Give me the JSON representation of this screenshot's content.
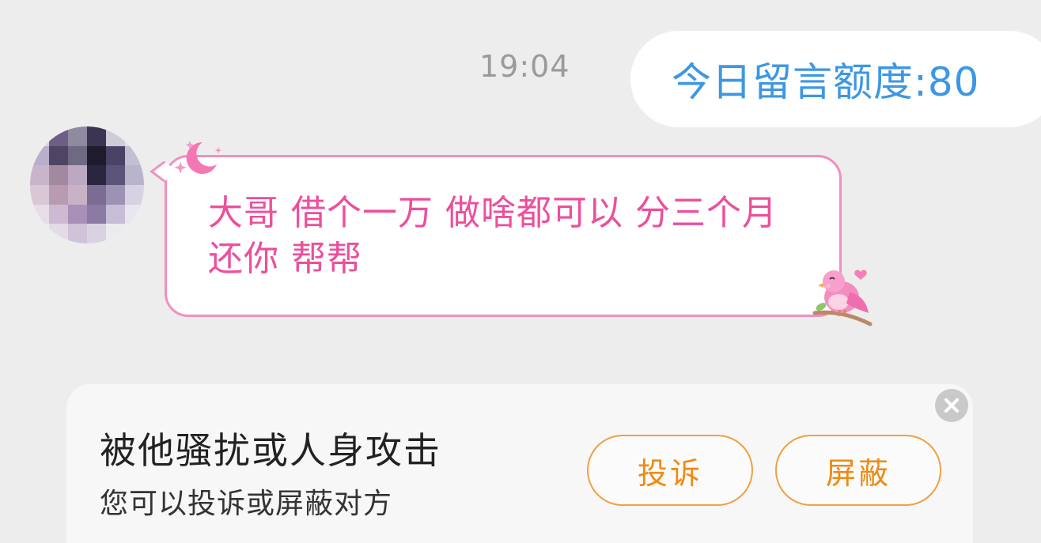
{
  "chat": {
    "timestamp": "19:04",
    "outgoing_message": "今日留言额度:80",
    "incoming_message": "大哥 借个一万 做啥都可以 分三个月还你 帮帮"
  },
  "icons": {
    "avatar": "avatar-icon",
    "moon": "moon-sticker-icon",
    "bird": "bird-sticker-icon",
    "close": "close-icon"
  },
  "safety": {
    "title": "被他骚扰或人身攻击",
    "subtitle": "您可以投诉或屏蔽对方",
    "report_label": "投诉",
    "block_label": "屏蔽"
  },
  "colors": {
    "outgoing_text": "#3d97e3",
    "incoming_text": "#ec4f9c",
    "incoming_border": "#f08fc0",
    "action_accent": "#ef8a12"
  }
}
